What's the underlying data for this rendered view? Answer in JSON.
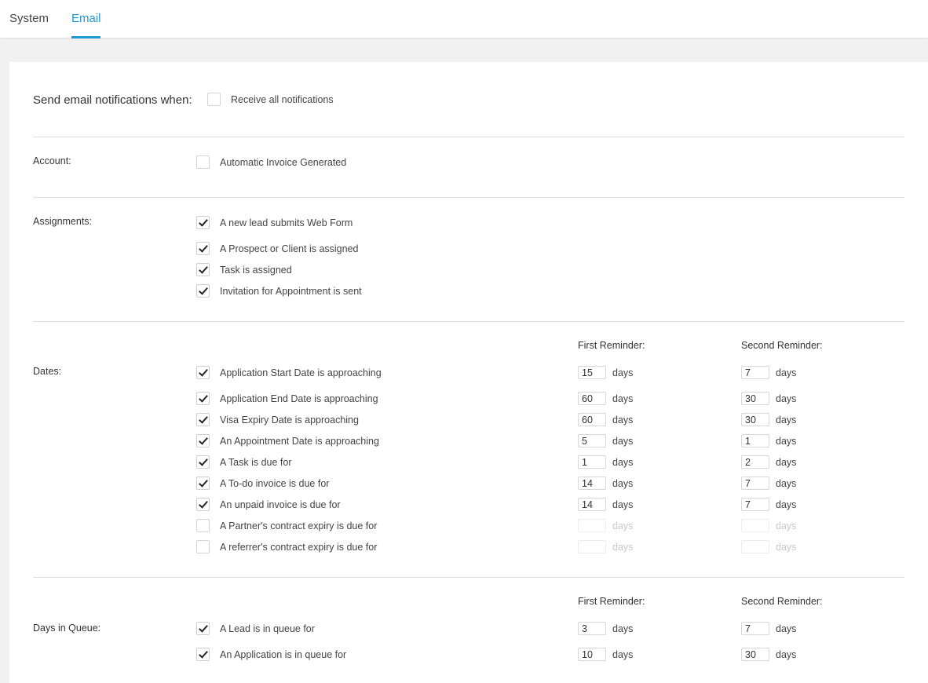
{
  "tabs": {
    "system": "System",
    "email": "Email"
  },
  "header": {
    "title": "Send email notifications when:",
    "receive_all_label": "Receive all notifications",
    "receive_all_checked": false
  },
  "account": {
    "label": "Account:",
    "items": [
      {
        "label": "Automatic Invoice Generated",
        "checked": false
      }
    ]
  },
  "assignments": {
    "label": "Assignments:",
    "items": [
      {
        "label": "A new lead submits Web Form",
        "checked": true
      },
      {
        "label": "A Prospect or Client is assigned",
        "checked": true
      },
      {
        "label": "Task is assigned",
        "checked": true
      },
      {
        "label": "Invitation for Appointment is sent",
        "checked": true
      }
    ]
  },
  "dates": {
    "label": "Dates:",
    "first_reminder": "First Reminder:",
    "second_reminder": "Second Reminder:",
    "unit": "days",
    "items": [
      {
        "label": "Application Start Date is approaching",
        "checked": true,
        "first": "15",
        "second": "7"
      },
      {
        "label": "Application End Date is approaching",
        "checked": true,
        "first": "60",
        "second": "30"
      },
      {
        "label": "Visa Expiry Date is approaching",
        "checked": true,
        "first": "60",
        "second": "30"
      },
      {
        "label": "An Appointment Date is approaching",
        "checked": true,
        "first": "5",
        "second": "1"
      },
      {
        "label": "A Task is due for",
        "checked": true,
        "first": "1",
        "second": "2"
      },
      {
        "label": "A To-do invoice is due for",
        "checked": true,
        "first": "14",
        "second": "7"
      },
      {
        "label": "An unpaid invoice is due for",
        "checked": true,
        "first": "14",
        "second": "7"
      },
      {
        "label": "A Partner's contract expiry is due for",
        "checked": false,
        "first": "",
        "second": ""
      },
      {
        "label": "A referrer's contract expiry is due for",
        "checked": false,
        "first": "",
        "second": ""
      }
    ]
  },
  "queue": {
    "label": "Days in Queue:",
    "first_reminder": "First Reminder:",
    "second_reminder": "Second Reminder:",
    "unit": "days",
    "items": [
      {
        "label": "A Lead is in queue for",
        "checked": true,
        "first": "3",
        "second": "7"
      },
      {
        "label": "An Application is in queue for",
        "checked": true,
        "first": "10",
        "second": "30"
      }
    ]
  },
  "colors": {
    "accent": "#1a9ad6",
    "page_bg": "#f1f1f1",
    "card_bg": "#ffffff"
  }
}
